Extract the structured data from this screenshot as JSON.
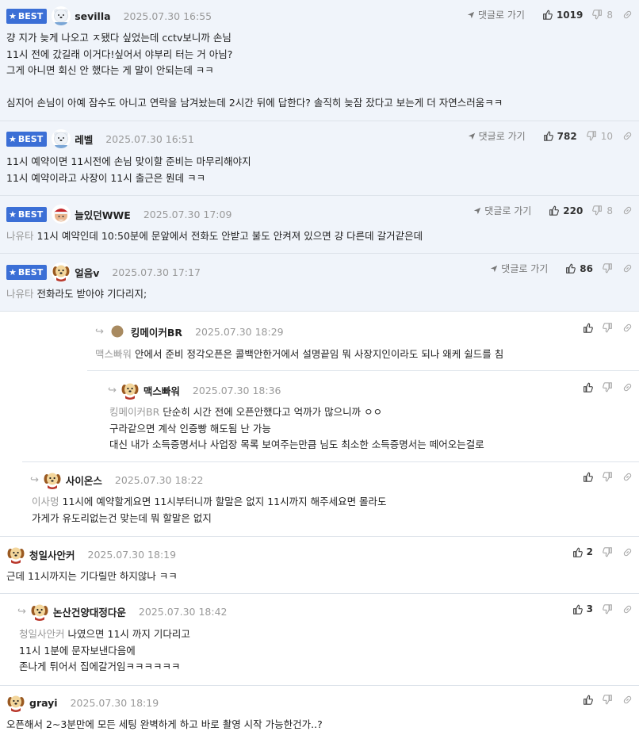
{
  "labels": {
    "best": "BEST",
    "reply_link": "댓글로 가기"
  },
  "colors": {
    "best_badge": "#3b6fd6",
    "best_bg": "#f0f4fa",
    "mention": "#999999"
  },
  "comments": [
    {
      "nick": "sevilla",
      "time": "2025.07.30 16:55",
      "avatar": "polar-bear-icon",
      "likes": "1019",
      "dislikes": "8",
      "lines": [
        "걍 지가 늦게 나오고 ㅈ됐다 싶었는데 cctv보니까 손님",
        "11시 전에 갔길래 이거다!싶어서 야부리 터는 거 아님?",
        "그게 아니면 회신 안 했다는 게 말이 안되는데 ㅋㅋ",
        "",
        "심지어 손님이 아예 잠수도 아니고 연락을 남겨놨는데 2시간 뒤에 답한다? 솔직히 늦잠 잤다고 보는게 더 자연스러움ㅋㅋ"
      ]
    },
    {
      "nick": "레벨",
      "time": "2025.07.30 16:51",
      "avatar": "polar-bear-icon",
      "likes": "782",
      "dislikes": "10",
      "lines": [
        "11시 예약이면 11시전에 손님 맞이할 준비는 마무리해야지",
        "11시 예약이라고 사장이 11시 출근은 뭔데 ㅋㅋ"
      ]
    },
    {
      "nick": "늘있던WWE",
      "time": "2025.07.30 17:09",
      "avatar": "santa-icon",
      "likes": "220",
      "dislikes": "8",
      "mention": "나유타",
      "lines": [
        "11시 예약인데 10:50분에 문앞에서 전화도 안받고 불도 안켜져 있으면 걍 다른데 갈거같은데"
      ]
    },
    {
      "nick": "얼음v",
      "time": "2025.07.30 17:17",
      "avatar": "puppy-icon",
      "likes": "86",
      "mention": "나유타",
      "lines": [
        "전화라도 받아야 기다리지;"
      ]
    },
    {
      "nick": "킹메이커BR",
      "time": "2025.07.30 18:29",
      "avatar": "brown-circle-icon",
      "mention": "맥스빠워",
      "lines": [
        "안에서 준비 정각오픈은 콜백안한거에서 설명끝임 뭐 사장지인이라도 되나 왜케 쉴드를 침"
      ]
    },
    {
      "nick": "맥스빠워",
      "time": "2025.07.30 18:36",
      "avatar": "puppy-icon",
      "mention": "킹메이커BR",
      "lines": [
        "단순히 시간 전에 오픈안했다고 억까가 많으니까 ㅇㅇ",
        "구라같으면 계삭 인증빵 해도됨 난 가능",
        "대신 내가 소득증명서나 사업장 목록 보여주는만큼 님도 최소한 소득증명서는 떼어오는걸로"
      ]
    },
    {
      "nick": "사이온스",
      "time": "2025.07.30 18:22",
      "avatar": "puppy-icon",
      "mention": "이사멍",
      "lines": [
        "11시에 예약할게요면 11시부터니까 할말은 없지 11시까지 해주세요면 몰라도",
        "가게가 유도리없는건 맞는데 뭐 할말은 없지"
      ]
    },
    {
      "nick": "청일사안커",
      "time": "2025.07.30 18:19",
      "avatar": "puppy-icon",
      "likes": "2",
      "lines": [
        "근데 11시까지는 기다릴만 하지않나 ㅋㅋ"
      ]
    },
    {
      "nick": "논산건양대정다운",
      "time": "2025.07.30 18:42",
      "avatar": "puppy-icon",
      "likes": "3",
      "mention": "청일사안커",
      "lines": [
        "나였으면 11시 까지 기다리고",
        "11시 1분에 문자보낸다음에",
        "존나게 튀어서 집에갈거임ㅋㅋㅋㅋㅋㅋ"
      ]
    },
    {
      "nick": "grayi",
      "time": "2025.07.30 18:19",
      "avatar": "puppy-icon",
      "lines": [
        "오픈해서 2~3분만에 모든 세팅 완벽하게 하고 바로 촬영 시작 가능한건가..?"
      ]
    }
  ]
}
